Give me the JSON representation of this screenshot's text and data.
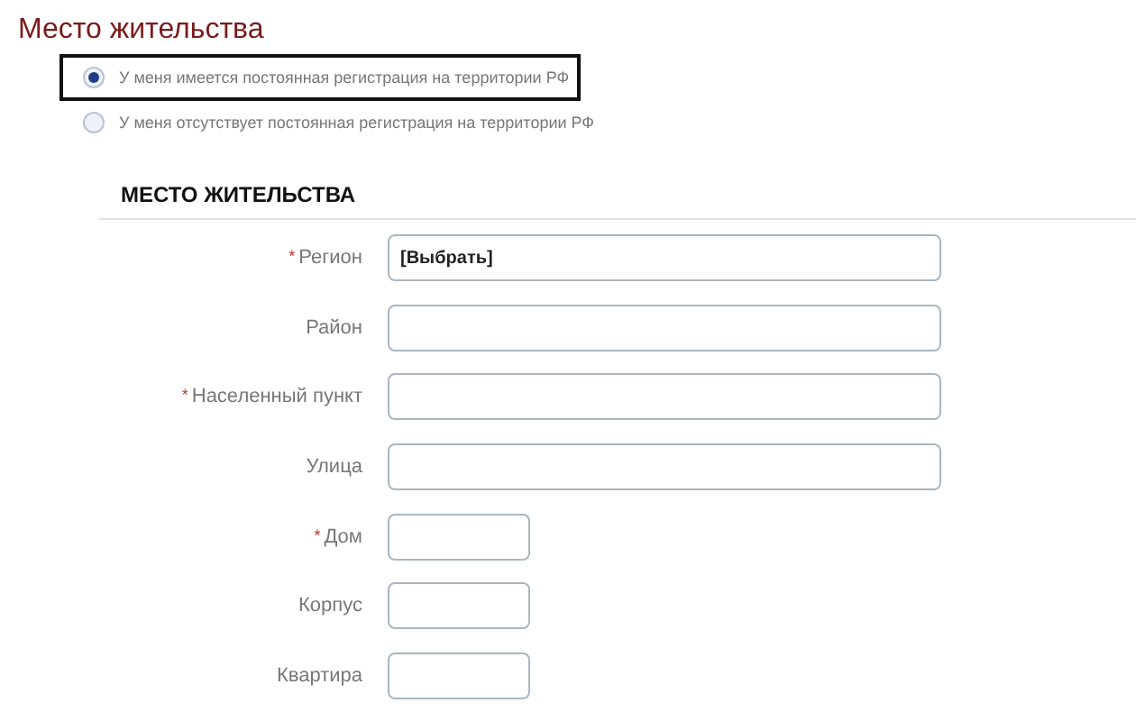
{
  "title": "Место жительства",
  "options": [
    {
      "label": "У меня имеется постоянная регистрация на территории РФ",
      "selected": true,
      "highlighted": true
    },
    {
      "label": "У меня отсутствует постоянная регистрация на территории РФ",
      "selected": false,
      "highlighted": false
    }
  ],
  "section": {
    "heading": "МЕСТО ЖИТЕЛЬСТВА",
    "fields": [
      {
        "label": "Регион",
        "required_mark": "*",
        "kind": "wide",
        "value": "[Выбрать]"
      },
      {
        "label": "Район",
        "kind": "wide"
      },
      {
        "label": "Населенный пункт",
        "required_mark": "*",
        "kind": "wide"
      },
      {
        "label": "Улица",
        "kind": "wide"
      },
      {
        "label": "Дом",
        "required_mark": "*",
        "kind": "short"
      },
      {
        "label": "Корпус",
        "kind": "short"
      },
      {
        "label": "Квартира",
        "kind": "short"
      }
    ]
  }
}
